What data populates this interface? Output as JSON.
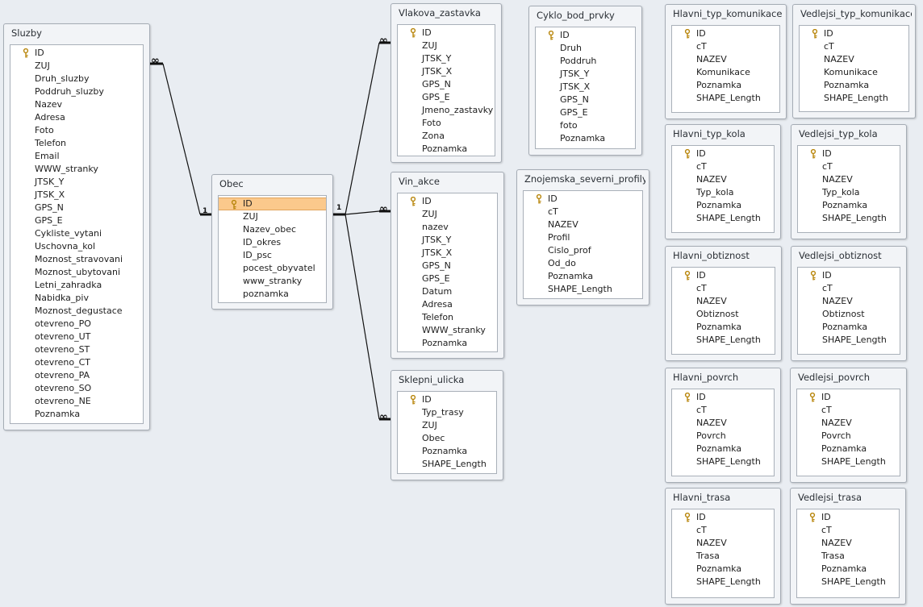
{
  "tables": [
    {
      "id": "sluzby",
      "name": "Sluzby",
      "fields": [
        "ID",
        "ZUJ",
        "Druh_sluzby",
        "Poddruh_sluzby",
        "Nazev",
        "Adresa",
        "Foto",
        "Telefon",
        "Email",
        "WWW_stranky",
        "JTSK_Y",
        "JTSK_X",
        "GPS_N",
        "GPS_E",
        "Cykliste_vytani",
        "Uschovna_kol",
        "Moznost_stravovani",
        "Moznost_ubytovani",
        "Letni_zahradka",
        "Nabidka_piv",
        "Moznost_degustace",
        "otevreno_PO",
        "otevreno_UT",
        "otevreno_ST",
        "otevreno_CT",
        "otevreno_PA",
        "otevreno_SO",
        "otevreno_NE",
        "Poznamka"
      ]
    },
    {
      "id": "obec",
      "name": "Obec",
      "selected_field": "ID",
      "fields": [
        "ID",
        "ZUJ",
        "Nazev_obec",
        "ID_okres",
        "ID_psc",
        "pocest_obyvatel",
        "www_stranky",
        "poznamka"
      ]
    },
    {
      "id": "vlakova_zastavka",
      "name": "Vlakova_zastavka",
      "fields": [
        "ID",
        "ZUJ",
        "JTSK_Y",
        "JTSK_X",
        "GPS_N",
        "GPS_E",
        "Jmeno_zastavky",
        "Foto",
        "Zona",
        "Poznamka"
      ]
    },
    {
      "id": "vin_akce",
      "name": "Vin_akce",
      "fields": [
        "ID",
        "ZUJ",
        "nazev",
        "JTSK_Y",
        "JTSK_X",
        "GPS_N",
        "GPS_E",
        "Datum",
        "Adresa",
        "Telefon",
        "WWW_stranky",
        "Poznamka"
      ]
    },
    {
      "id": "sklepni_ulicka",
      "name": "Sklepni_ulicka",
      "fields": [
        "ID",
        "Typ_trasy",
        "ZUJ",
        "Obec",
        "Poznamka",
        "SHAPE_Length"
      ]
    },
    {
      "id": "cyklo_bod_prvky",
      "name": "Cyklo_bod_prvky",
      "fields": [
        "ID",
        "Druh",
        "Poddruh",
        "JTSK_Y",
        "JTSK_X",
        "GPS_N",
        "GPS_E",
        "foto",
        "Poznamka"
      ]
    },
    {
      "id": "znojemska_severni_profily",
      "name": "Znojemska_severni_profily",
      "fields": [
        "ID",
        "cT",
        "NAZEV",
        "Profil",
        "Cislo_prof",
        "Od_do",
        "Poznamka",
        "SHAPE_Length"
      ]
    },
    {
      "id": "hlavni_typ_komunikace",
      "name": "Hlavni_typ_komunikace",
      "fields": [
        "ID",
        "cT",
        "NAZEV",
        "Komunikace",
        "Poznamka",
        "SHAPE_Length"
      ]
    },
    {
      "id": "vedlejsi_typ_komunikace",
      "name": "Vedlejsi_typ_komunikace",
      "fields": [
        "ID",
        "cT",
        "NAZEV",
        "Komunikace",
        "Poznamka",
        "SHAPE_Length"
      ]
    },
    {
      "id": "hlavni_typ_kola",
      "name": "Hlavni_typ_kola",
      "fields": [
        "ID",
        "cT",
        "NAZEV",
        "Typ_kola",
        "Poznamka",
        "SHAPE_Length"
      ]
    },
    {
      "id": "vedlejsi_typ_kola",
      "name": "Vedlejsi_typ_kola",
      "fields": [
        "ID",
        "cT",
        "NAZEV",
        "Typ_kola",
        "Poznamka",
        "SHAPE_Length"
      ]
    },
    {
      "id": "hlavni_obtiznost",
      "name": "Hlavni_obtiznost",
      "fields": [
        "ID",
        "cT",
        "NAZEV",
        "Obtiznost",
        "Poznamka",
        "SHAPE_Length"
      ]
    },
    {
      "id": "vedlejsi_obtiznost",
      "name": "Vedlejsi_obtiznost",
      "fields": [
        "ID",
        "cT",
        "NAZEV",
        "Obtiznost",
        "Poznamka",
        "SHAPE_Length"
      ]
    },
    {
      "id": "hlavni_povrch",
      "name": "Hlavni_povrch",
      "fields": [
        "ID",
        "cT",
        "NAZEV",
        "Povrch",
        "Poznamka",
        "SHAPE_Length"
      ]
    },
    {
      "id": "vedlejsi_povrch",
      "name": "Vedlejsi_povrch",
      "fields": [
        "ID",
        "cT",
        "NAZEV",
        "Povrch",
        "Poznamka",
        "SHAPE_Length"
      ]
    },
    {
      "id": "hlavni_trasa",
      "name": "Hlavni_trasa",
      "fields": [
        "ID",
        "cT",
        "NAZEV",
        "Trasa",
        "Poznamka",
        "SHAPE_Length"
      ]
    },
    {
      "id": "vedlejsi_trasa",
      "name": "Vedlejsi_trasa",
      "fields": [
        "ID",
        "cT",
        "NAZEV",
        "Trasa",
        "Poznamka",
        "SHAPE_Length"
      ]
    }
  ],
  "relationships": [
    {
      "from": "obec",
      "to": "sluzby",
      "one_label": "1",
      "many_label": "∞"
    },
    {
      "from": "obec",
      "to": "vlakova_zastavka",
      "one_label": "1",
      "many_label": "∞"
    },
    {
      "from": "obec",
      "to": "vin_akce",
      "one_label": "1",
      "many_label": "∞"
    },
    {
      "from": "obec",
      "to": "sklepni_ulicka",
      "one_label": "1",
      "many_label": "∞"
    }
  ],
  "icons": {
    "primary_key": "key-icon"
  },
  "colors": {
    "selected_field": "#fbc98c",
    "relation_line": "#111111",
    "canvas": "#e9edf2"
  }
}
